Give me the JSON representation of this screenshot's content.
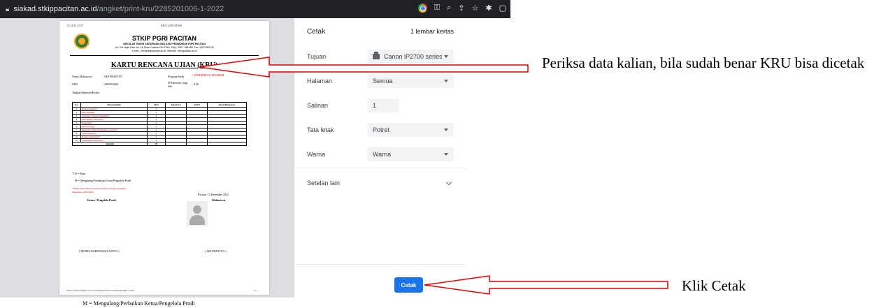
{
  "browser": {
    "url_host": "siakad.stkippacitan.ac.id",
    "url_path": "/angket/print-kru/2285201006-1-2022",
    "lock_icon": "lock-icon",
    "right_icons": [
      "chrome-icon",
      "key-icon",
      "zoom-icon",
      "share-icon",
      "star-icon",
      "extensions-icon",
      "sidebar-icon"
    ]
  },
  "document": {
    "header_date": "13/12/22 13.07",
    "header_doc": "KRU-2285201006",
    "institution": "STKIP PGRI PACITAN",
    "institution_sub": "SEKOLAH TINGGI KEGURUAN DAN ILMU PENDIDIKAN PGRI PACITAN",
    "address": "Jln. Cut Nyak Dien No. 4A Ploso Pacitan PACITAN, Telp/: 0357- 881488, Fax. 0357 884742",
    "email": "e-mail : info@stkippacitan.ac.id, Website : stkippacitan.ac.id",
    "title": "KARTU RENCANA UJIAN (KRU)",
    "nama_label": "Nama Mahasiswa",
    "nama_value": ": ADI PRASTYO",
    "prodi_label": "Program Studi",
    "prodi_value": ": PENDIDIKAN SEJARAH",
    "nim_label": "NIM",
    "nim_value": ": 2285201006",
    "ip_label": "IP Semester yang lalu",
    "ip_value": ": 0.00",
    "tingkat_label": "Tingkat/Semester/Kelas :",
    "table_headers": [
      "No.",
      "Mata Kuliah",
      "SKS",
      "Ujian Ke",
      "Ket*)",
      "Paraf Pengawas"
    ],
    "rows": [
      {
        "no": "1",
        "mk": "Bahasa Inggris*",
        "sks": "2"
      },
      {
        "no": "2",
        "mk": "Ilmu Politik*",
        "sks": "2"
      },
      {
        "no": "3",
        "mk": "Pengantar Ilmu Pendidikan*",
        "sks": "2"
      },
      {
        "no": "4",
        "mk": "Pendidikan Pancasila*",
        "sks": "2"
      },
      {
        "no": "5",
        "mk": "Sosiologi*",
        "sks": "2"
      },
      {
        "no": "6",
        "mk": "Antropologi*",
        "sks": "2"
      },
      {
        "no": "7",
        "mk": "Pengantar Ilmu Pendidikan Sejarah*",
        "sks": "2"
      },
      {
        "no": "8",
        "mk": "Sejarah Eropa*",
        "sks": "2"
      },
      {
        "no": "9",
        "mk": "Bahasa Indonesia*",
        "sks": "2"
      },
      {
        "no": "10",
        "mk": "Pendidikan Pancasila*",
        "sks": "2"
      }
    ],
    "total_label": "Jumlah",
    "total_sks": "20",
    "note_b": "*) B = Baru",
    "note_m": "M = Mengulang/Perbaikan Ketua/Pengelola Prodi",
    "warning": "*Nama mata kuliah bertanda bintang sebagai pengguna",
    "warning2": "mahasiswa dibatalkan",
    "place_date": "Pacitan, 13 Desember 2022",
    "ketua_label": "Ketua / Pengelola Prodi,",
    "mhs_label": "Mahasiswa,",
    "ketua_name": "( REDHA KURNIAWAN ANTUS )",
    "mhs_name": "( ADI PRASTYO )",
    "page_footer_url": "https://siakad.stkippacitan.ac.id/angket/print-kru/2285201006-1-2022",
    "page_number": "1/1",
    "below_line": "M = Mengulang/Perbaikan Ketua/Pengelola Prodi"
  },
  "print_panel": {
    "title": "Cetak",
    "sheet_count": "1 lembar kertas",
    "destination_label": "Tujuan",
    "destination_value": "Canon iP2700 series",
    "pages_label": "Halaman",
    "pages_value": "Semua",
    "copies_label": "Salinan",
    "copies_value": "1",
    "layout_label": "Tata letak",
    "layout_value": "Potret",
    "color_label": "Warna",
    "color_value": "Warna",
    "more_settings_label": "Setelan lain",
    "print_button": "Cetak"
  },
  "annotations": {
    "note1": "Periksa data kalian, bila sudah benar KRU bisa dicetak",
    "note2": "Klik Cetak",
    "arrow_color": "#e00000"
  }
}
